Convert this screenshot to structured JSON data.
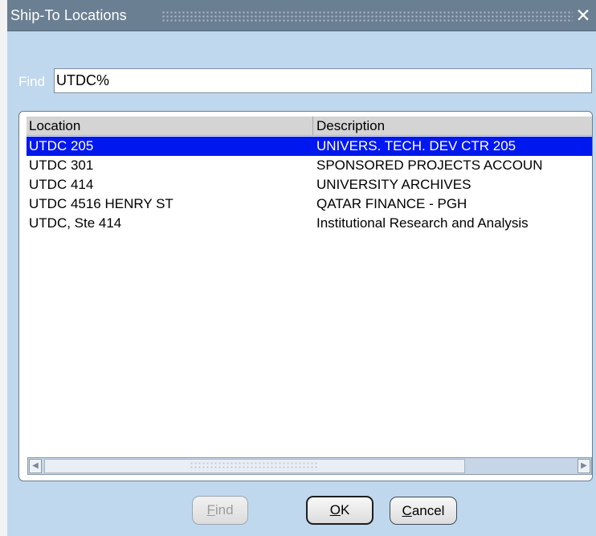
{
  "dialog": {
    "title": "Ship-To Locations",
    "close_glyph": "✕"
  },
  "find": {
    "label": "Find",
    "value": "UTDC%"
  },
  "list": {
    "columns": [
      "Location",
      "Description"
    ],
    "rows": [
      {
        "location": "UTDC 205",
        "description": "UNIVERS. TECH. DEV CTR 205",
        "selected": true
      },
      {
        "location": "UTDC 301",
        "description": "SPONSORED PROJECTS ACCOUN",
        "selected": false
      },
      {
        "location": "UTDC 414",
        "description": "UNIVERSITY ARCHIVES",
        "selected": false
      },
      {
        "location": "UTDC 4516 HENRY ST",
        "description": "QATAR FINANCE - PGH",
        "selected": false
      },
      {
        "location": "UTDC, Ste 414",
        "description": "Institutional Research and Analysis",
        "selected": false
      }
    ]
  },
  "scrollbar": {
    "left_arrow": "◀",
    "right_arrow": "▶"
  },
  "buttons": {
    "find": {
      "mnemonic": "F",
      "rest": "ind",
      "enabled": false
    },
    "ok": {
      "mnemonic": "O",
      "rest": "K",
      "default": true
    },
    "cancel": {
      "mnemonic": "C",
      "rest": "ancel"
    }
  },
  "colors": {
    "dialog_bg": "#c0d8ee",
    "titlebar_bg": "#6b7f93",
    "selection_bg": "#0018f0"
  },
  "icons": {
    "close": "close-icon",
    "scroll_left": "chevron-left-icon",
    "scroll_right": "chevron-right-icon"
  }
}
